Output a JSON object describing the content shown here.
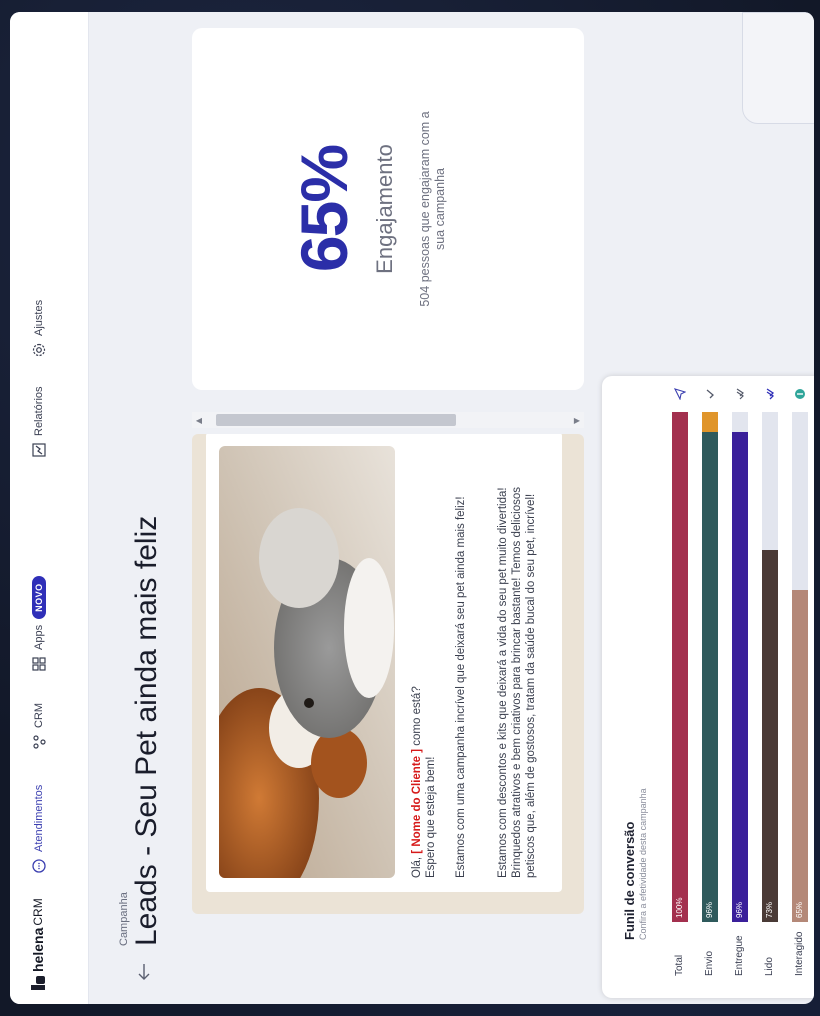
{
  "nav": {
    "brand": "helena",
    "brand_suffix": "CRM",
    "items": [
      {
        "label": "Atendimentos",
        "icon": "chat-icon"
      },
      {
        "label": "CRM",
        "icon": "crm-nodes-icon"
      },
      {
        "label": "Apps",
        "icon": "grid-icon"
      },
      {
        "label": "Relatórios",
        "icon": "report-icon"
      },
      {
        "label": "Ajustes",
        "icon": "gear-icon"
      }
    ],
    "badge": "NOVO"
  },
  "campaign": {
    "label": "Campanha",
    "title": "Leads - Seu Pet ainda mais feliz"
  },
  "message": {
    "greeting_prefix": "Olá, ",
    "client_tag": "[ Nome do Cliente ]",
    "greeting_suffix": " como está?",
    "line2": "Espero que esteja bem!",
    "paragraph2": "Estamos com uma campanha incrível que deixará seu pet ainda mais feliz!",
    "paragraph3": "Estamos com descontos e kits que deixará a vida do seu pet muito divertida! Brinquedos atrativos e bem criativos para brincar bastante! Temos deliciosos petiscos que, além de gostosos, tratam da saúde bucal do seu pet, incrível!",
    "image": "dog-and-cat-photo"
  },
  "engagement": {
    "percent": "65%",
    "label": "Engajamento",
    "description": "504 pessoas que engajaram com a sua campanha"
  },
  "funnel": {
    "title": "Funil de conversão",
    "subtitle": "Confira a efetividade desta campanha",
    "stages": [
      {
        "label": "Total",
        "pct_label": "100%",
        "value": 100,
        "color": "#a3304e",
        "extra": 0,
        "extra_color": "",
        "icon": "send-icon"
      },
      {
        "label": "Envio",
        "pct_label": "96%",
        "value": 96,
        "color": "#2f5a5c",
        "extra": 4,
        "extra_color": "#e0952a",
        "icon": "check-icon"
      },
      {
        "label": "Entregue",
        "pct_label": "96%",
        "value": 96,
        "color": "#3a1f9a",
        "extra": 0,
        "extra_color": "",
        "icon": "double-check-icon"
      },
      {
        "label": "Lido",
        "pct_label": "73%",
        "value": 73,
        "color": "#4a3a36",
        "extra": 0,
        "extra_color": "",
        "icon": "read-check-icon"
      },
      {
        "label": "Interagido",
        "pct_label": "65%",
        "value": 65,
        "color": "#b48878",
        "extra": 0,
        "extra_color": "",
        "icon": "interaction-icon"
      }
    ]
  }
}
